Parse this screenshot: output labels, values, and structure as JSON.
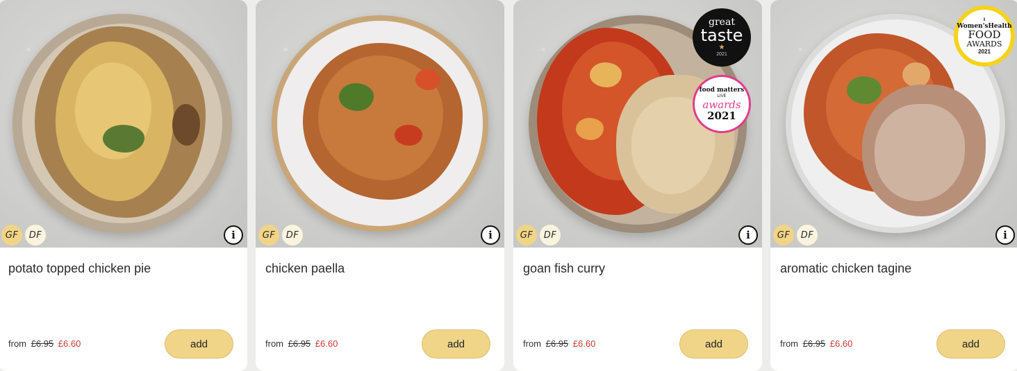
{
  "products": [
    {
      "title": "potato topped chicken pie",
      "price_from_label": "from",
      "price_was": "£6.95",
      "price_now": "£6.60",
      "add_label": "add",
      "diet_badges": [
        "GF",
        "DF"
      ],
      "info_icon": "info-icon",
      "awards": []
    },
    {
      "title": "chicken paella",
      "price_from_label": "from",
      "price_was": "£6.95",
      "price_now": "£6.60",
      "add_label": "add",
      "diet_badges": [
        "GF",
        "DF"
      ],
      "info_icon": "info-icon",
      "awards": []
    },
    {
      "title": "goan fish curry",
      "price_from_label": "from",
      "price_was": "£6.95",
      "price_now": "£6.60",
      "add_label": "add",
      "diet_badges": [
        "GF",
        "DF"
      ],
      "info_icon": "info-icon",
      "awards": [
        {
          "name": "great-taste",
          "line1": "great",
          "line2": "taste",
          "line3": "★",
          "line4": "2021"
        },
        {
          "name": "food-matters-live",
          "line1": "food matters",
          "line2": "LIVE",
          "line3": "awards",
          "line4": "2021"
        }
      ]
    },
    {
      "title": "aromatic chicken tagine",
      "price_from_label": "from",
      "price_was": "£6.95",
      "price_now": "£6.60",
      "add_label": "add",
      "diet_badges": [
        "GF",
        "DF"
      ],
      "info_icon": "info-icon",
      "awards": [
        {
          "name": "womens-health-food-awards",
          "line1": "Ⅱ",
          "line2": "Women'sHealth",
          "line3": "FOOD",
          "line4": "AWARDS",
          "line5": "2021"
        }
      ]
    }
  ],
  "colors": {
    "add_button": "#f0d488",
    "price_sale": "#d0382e",
    "badge_gf": "#f1d486",
    "badge_df": "#faf4df",
    "award_pink": "#e23b8b",
    "award_yellow": "#f5d21d"
  }
}
